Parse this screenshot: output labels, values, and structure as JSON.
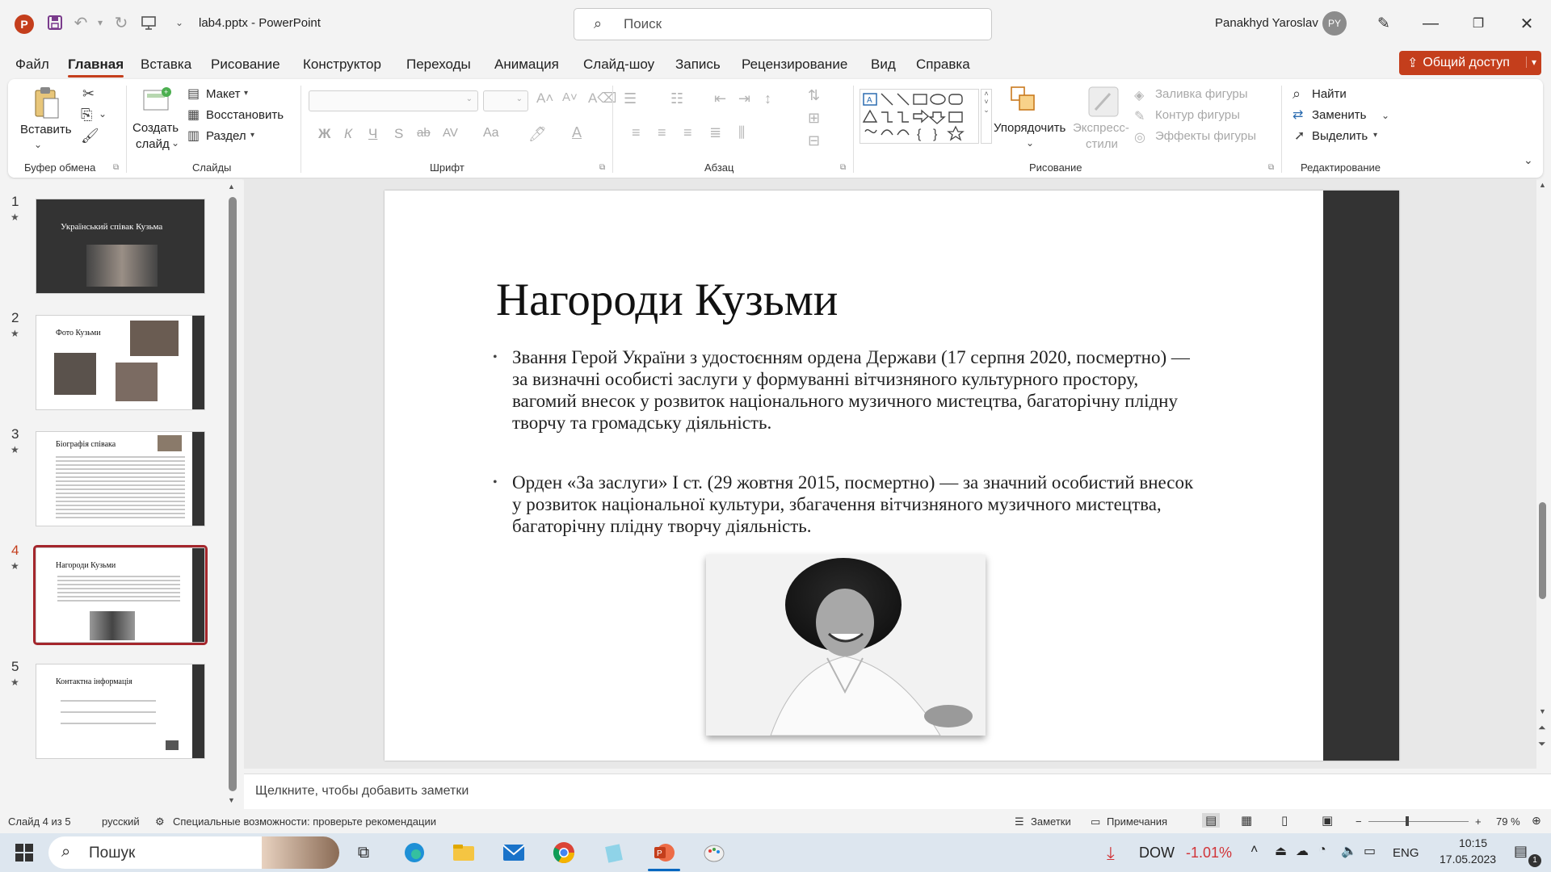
{
  "titlebar": {
    "doc_title": "lab4.pptx  -  PowerPoint",
    "search_placeholder": "Поиск",
    "user_name": "Panakhyd Yaroslav",
    "avatar_initials": "PY"
  },
  "menu": {
    "tabs": [
      "Файл",
      "Главная",
      "Вставка",
      "Рисование",
      "Конструктор",
      "Переходы",
      "Анимация",
      "Слайд-шоу",
      "Запись",
      "Рецензирование",
      "Вид",
      "Справка"
    ],
    "active": "Главная",
    "share_label": "Общий доступ"
  },
  "ribbon": {
    "clipboard": {
      "paste": "Вставить",
      "label": "Буфер обмена"
    },
    "slides": {
      "new_slide_1": "Создать",
      "new_slide_2": "слайд",
      "layout": "Макет",
      "reset": "Восстановить",
      "section": "Раздел",
      "label": "Слайды"
    },
    "font": {
      "label": "Шрифт",
      "bold": "Ж",
      "italic": "К",
      "underline": "Ч",
      "shadow": "S",
      "strike": "ab",
      "spacing": "AV",
      "case": "Aa"
    },
    "paragraph": {
      "label": "Абзац"
    },
    "drawing": {
      "arrange_1": "Упорядочить",
      "quick_styles_1": "Экспресс-",
      "quick_styles_2": "стили",
      "fill": "Заливка фигуры",
      "outline": "Контур фигуры",
      "effects": "Эффекты фигуры",
      "label": "Рисование"
    },
    "editing": {
      "find": "Найти",
      "replace": "Заменить",
      "select": "Выделить",
      "label": "Редактирование"
    }
  },
  "thumbnails": [
    {
      "num": "1",
      "title": "Український співак Кузьма"
    },
    {
      "num": "2",
      "title": "Фото Кузьми"
    },
    {
      "num": "3",
      "title": "Біографія співака"
    },
    {
      "num": "4",
      "title": "Нагороди Кузьми"
    },
    {
      "num": "5",
      "title": "Контактна інформація"
    }
  ],
  "slide": {
    "title": "Нагороди Кузьми",
    "bullet1": "Звання Герой України з удостоєнням ордена Держави (17 серпня 2020, посмертно) — за визначні особисті заслуги у формуванні вітчизняного культурного простору, вагомий внесок у розвиток національного музичного мистецтва, багаторічну плідну творчу та громадську діяльність.",
    "bullet2": "Орден «За заслуги» I ст. (29 жовтня 2015, посмертно) — за значний особистий внесок у розвиток національної культури, збагачення вітчизняного музичного мистецтва, багаторічну плідну творчу діяльність."
  },
  "notes_placeholder": "Щелкните, чтобы добавить заметки",
  "status": {
    "slide_info": "Слайд 4 из 5",
    "language": "русский",
    "accessibility": "Специальные возможности: проверьте рекомендации",
    "notes": "Заметки",
    "comments": "Примечания",
    "zoom": "79 %"
  },
  "taskbar": {
    "search": "Пошук",
    "dow_label": "DOW",
    "dow_change": "-1.01%",
    "lang": "ENG",
    "time": "10:15",
    "date": "17.05.2023",
    "notif_count": "1"
  },
  "colors": {
    "accent": "#c43e1c",
    "selected_thumb": "#a4262c",
    "slide_band": "#333333",
    "dow_negative": "#d13438"
  }
}
